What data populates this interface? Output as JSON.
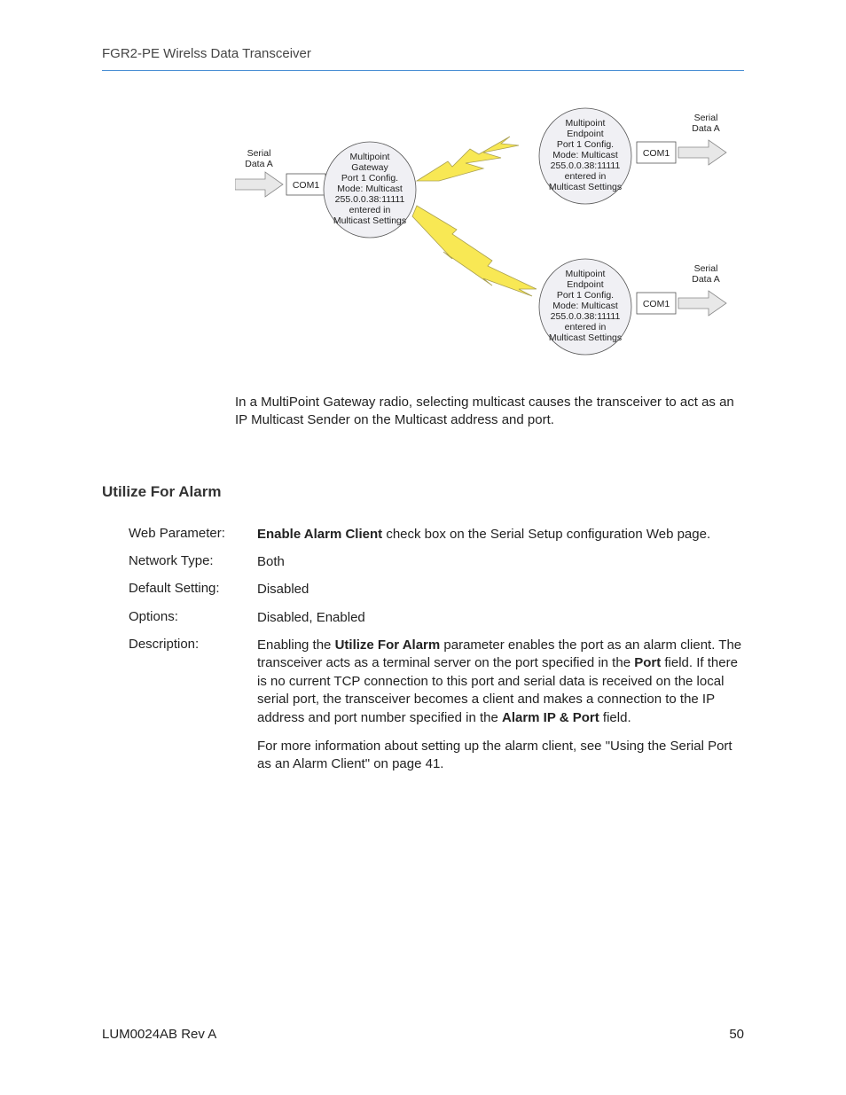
{
  "header": {
    "title": "FGR2-PE Wirelss Data Transceiver"
  },
  "diagram": {
    "left_serial": {
      "l1": "Serial",
      "l2": "Data A"
    },
    "right_serial_1": {
      "l1": "Serial",
      "l2": "Data A"
    },
    "right_serial_2": {
      "l1": "Serial",
      "l2": "Data A"
    },
    "com_left": "COM1",
    "com_r1": "COM1",
    "com_r2": "COM1",
    "gateway": {
      "l1": "Multipoint",
      "l2": "Gateway",
      "l3": "Port 1 Config.",
      "l4": "Mode: Multicast",
      "l5": "255.0.0.38:11111",
      "l6": "entered in",
      "l7": "Multicast Settings"
    },
    "endpoint1": {
      "l1": "Multipoint",
      "l2": "Endpoint",
      "l3": "Port 1 Config.",
      "l4": "Mode: Multicast",
      "l5": "255.0.0.38:11111",
      "l6": "entered in",
      "l7": "Multicast Settings"
    },
    "endpoint2": {
      "l1": "Multipoint",
      "l2": "Endpoint",
      "l3": "Port 1 Config.",
      "l4": "Mode: Multicast",
      "l5": "255.0.0.38:11111",
      "l6": "entered in",
      "l7": "Multicast Settings"
    }
  },
  "body": {
    "intro": "In a MultiPoint Gateway radio, selecting multicast causes the transceiver to act as an IP Multicast Sender on the Multicast address and port."
  },
  "section": {
    "heading": "Utilize For Alarm",
    "rows": {
      "web_param_label": "Web Parameter:",
      "web_param_bold": "Enable Alarm Client",
      "web_param_rest": " check box on the Serial Setup configuration Web page.",
      "network_type_label": "Network Type:",
      "network_type_value": "Both",
      "default_setting_label": "Default Setting:",
      "default_setting_value": "Disabled",
      "options_label": "Options:",
      "options_value": "Disabled, Enabled",
      "description_label": "Description:",
      "desc_p1_a": "Enabling the ",
      "desc_p1_b": "Utilize For Alarm",
      "desc_p1_c": " parameter enables the port as an alarm client. The transceiver acts as a terminal server on the port specified in the ",
      "desc_p1_d": "Port",
      "desc_p1_e": " field. If there is no current TCP connection to this port and serial data is received on the local serial port, the transceiver becomes a client and makes a connection to the IP address and port number specified in the ",
      "desc_p1_f": "Alarm IP & Port",
      "desc_p1_g": " field.",
      "desc_p2": "For more information about setting up the alarm client, see \"Using the Serial Port as an Alarm Client\" on page 41."
    }
  },
  "footer": {
    "left": "LUM0024AB Rev A",
    "right": "50"
  }
}
